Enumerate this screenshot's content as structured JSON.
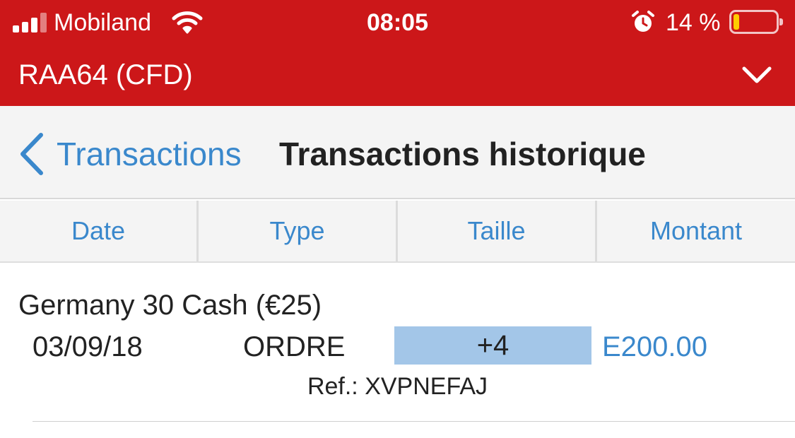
{
  "status_bar": {
    "carrier": "Mobiland",
    "time": "08:05",
    "battery_percent": "14 %",
    "battery_level": 0.14,
    "signal_bars": 4,
    "signal_bars_active": 3,
    "icons": [
      "signal-icon",
      "wifi-icon",
      "alarm-icon",
      "battery-icon"
    ]
  },
  "account": {
    "title": "RAA64 (CFD)",
    "dropdown_icon": "chevron-down-icon"
  },
  "nav": {
    "back_label": "Transactions",
    "back_icon": "chevron-left-icon",
    "title": "Transactions historique"
  },
  "columns": [
    "Date",
    "Type",
    "Taille",
    "Montant"
  ],
  "transactions": [
    {
      "instrument": "Germany 30 Cash (€25)",
      "date": "03/09/18",
      "type": "ORDRE",
      "size": "+4",
      "amount": "E200.00",
      "reference": "Ref.: XVPNEFAJ"
    }
  ],
  "colors": {
    "header_red": "#cc1719",
    "link_blue": "#3a88cc",
    "size_highlight": "#a3c6e8",
    "nav_background": "#f4f4f4",
    "battery_low": "#ffcc00"
  }
}
